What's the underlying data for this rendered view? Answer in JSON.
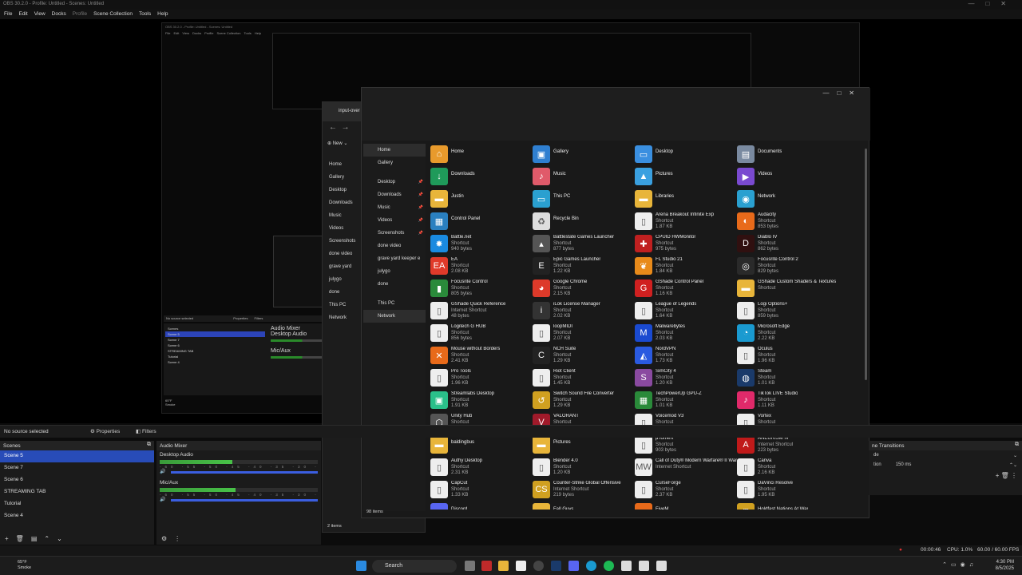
{
  "obs": {
    "title": "OBS 30.2.0 - Profile: Untitled - Scenes: Untitled",
    "menu": [
      "File",
      "Edit",
      "View",
      "Docks",
      "Profile",
      "Scene Collection",
      "Tools",
      "Help"
    ],
    "no_source": "No source selected",
    "properties": "Properties",
    "filters": "Filters",
    "scenes_title": "Scenes",
    "scenes": [
      "Scene 5",
      "Scene 7",
      "Scene 6",
      "STREAMING TAB",
      "Tutorial",
      "Scene 4"
    ],
    "mixer_title": "Audio Mixer",
    "desktop_audio": "Desktop Audio",
    "mic_aux": "Mic/Aux",
    "desktop_level": 0.46,
    "mic_level": 0.48,
    "scale": "-60 -55 -50 -45 -40 -35 -30 -25 -20",
    "transitions_title": "ne Transitions",
    "transition_type": "de",
    "duration_label": "tion",
    "duration": "150 ms",
    "status": {
      "rec_time": "00:00:46",
      "cpu": "CPU: 1.0%",
      "fps": "60.00 / 60.00 FPS"
    }
  },
  "nested": {
    "title": "OBS 30.2.0 - Profile: Untitled - Scenes: Untitled",
    "menu": [
      "File",
      "Edit",
      "View",
      "Docks",
      "Profile",
      "Scene Collection",
      "Tools",
      "Help"
    ],
    "no_source": "No source selected",
    "properties": "Properties",
    "filters": "Filters",
    "scenes_title": "Scenes",
    "scenes": [
      "Scene 5",
      "Scene 7",
      "Scene 6",
      "STREAMING TAB",
      "Tutorial",
      "Scene 4"
    ],
    "mixer_title": "Audio Mixer",
    "desktop_audio": "Desktop Audio",
    "mic_aux": "Mic/Aux",
    "weather": "65°F",
    "weather_sub": "Smoke"
  },
  "explorer_back": {
    "tab": "input-over",
    "new": "New",
    "sidebar": [
      "Home",
      "Gallery",
      "Desktop",
      "Downloads",
      "Music",
      "Videos",
      "Screenshots",
      "done video",
      "grave yard",
      "julygo",
      "done",
      "This PC",
      "Network"
    ],
    "footer": "2 items"
  },
  "explorer": {
    "sidebar": [
      {
        "label": "Home",
        "sel": true
      },
      {
        "label": "Gallery"
      },
      {
        "sep": true
      },
      {
        "label": "Desktop",
        "pin": true
      },
      {
        "label": "Downloads",
        "pin": true
      },
      {
        "label": "Music",
        "pin": true
      },
      {
        "label": "Videos",
        "pin": true
      },
      {
        "label": "Screenshots",
        "pin": true
      },
      {
        "label": "done video"
      },
      {
        "label": "grave yard keeper e"
      },
      {
        "label": "julygo"
      },
      {
        "label": "done"
      },
      {
        "sep": true
      },
      {
        "label": "This PC"
      },
      {
        "label": "Network",
        "sel": true
      }
    ],
    "footer": "98 items",
    "items": [
      {
        "n": "Home",
        "c": "#e89a2c",
        "g": "⌂"
      },
      {
        "n": "Gallery",
        "c": "#2f7fd0",
        "g": "▣"
      },
      {
        "n": "Desktop",
        "c": "#3a8fe0",
        "g": "▭"
      },
      {
        "n": "Documents",
        "c": "#7a8aa0",
        "g": "▤"
      },
      {
        "n": "Downloads",
        "c": "#1f9a5a",
        "g": "↓"
      },
      {
        "n": "Music",
        "c": "#e05a6a",
        "g": "♪"
      },
      {
        "n": "Pictures",
        "c": "#3aa0e0",
        "g": "▲"
      },
      {
        "n": "Videos",
        "c": "#7a4ad0",
        "g": "▶"
      },
      {
        "n": "Justin",
        "c": "#e8b53a",
        "g": "▬"
      },
      {
        "n": "This PC",
        "c": "#2aa0d0",
        "g": "▭"
      },
      {
        "n": "Libraries",
        "c": "#e8b53a",
        "g": "▬"
      },
      {
        "n": "Network",
        "c": "#2aa0d0",
        "g": "◉"
      },
      {
        "n": "Control Panel",
        "c": "#2a80c0",
        "g": "▦"
      },
      {
        "n": "Recycle Bin",
        "c": "#ddd",
        "g": "♻"
      },
      {
        "n": "Arena Breakout Infinite Exp",
        "s": "Shortcut",
        "z": "1.87 KB",
        "c": "#eee",
        "g": "▯"
      },
      {
        "n": "Audacity",
        "s": "Shortcut",
        "z": "853 bytes",
        "c": "#e86a1a",
        "g": "◐"
      },
      {
        "n": "Battle.net",
        "s": "Shortcut",
        "z": "940 bytes",
        "c": "#1a8ae0",
        "g": "✸"
      },
      {
        "n": "Battlestate Games Launcher",
        "s": "Shortcut",
        "z": "877 bytes",
        "c": "#555",
        "g": "▴"
      },
      {
        "n": "CPUID HWMonitor",
        "s": "Shortcut",
        "z": "975 bytes",
        "c": "#c02020",
        "g": "✚"
      },
      {
        "n": "Diablo IV",
        "s": "Shortcut",
        "z": "862 bytes",
        "c": "#301010",
        "g": "D"
      },
      {
        "n": "EA",
        "s": "Shortcut",
        "z": "2.08 KB",
        "c": "#e03a2a",
        "g": "EA"
      },
      {
        "n": "Epic Games Launcher",
        "s": "Shortcut",
        "z": "1.22 KB",
        "c": "#222",
        "g": "E"
      },
      {
        "n": "FL Studio 21",
        "s": "Shortcut",
        "z": "1.84 KB",
        "c": "#e88a1a",
        "g": "❦"
      },
      {
        "n": "Focusrite Control 2",
        "s": "Shortcut",
        "z": "829 bytes",
        "c": "#2a2a2a",
        "g": "◎"
      },
      {
        "n": "Focusrite Control",
        "s": "Shortcut",
        "z": "805 bytes",
        "c": "#2a8a3a",
        "g": "▮"
      },
      {
        "n": "Google Chrome",
        "s": "Shortcut",
        "z": "2.15 KB",
        "c": "#dd3a2a",
        "g": "◕"
      },
      {
        "n": "GShade Control Panel",
        "s": "Shortcut",
        "z": "1.16 KB",
        "c": "#d02020",
        "g": "G"
      },
      {
        "n": "GShade Custom Shaders & Textures",
        "s": "Shortcut",
        "c": "#e8b53a",
        "g": "▬"
      },
      {
        "n": "GShade Quick Reference",
        "s": "Internet Shortcut",
        "z": "48 bytes",
        "c": "#eee",
        "g": "▯"
      },
      {
        "n": "iLok License Manager",
        "s": "Shortcut",
        "z": "2.02 KB",
        "c": "#333",
        "g": "i"
      },
      {
        "n": "League of Legends",
        "s": "Shortcut",
        "z": "1.64 KB",
        "c": "#eee",
        "g": "▯"
      },
      {
        "n": "Logi Options+",
        "s": "Shortcut",
        "z": "859 bytes",
        "c": "#eee",
        "g": "▯"
      },
      {
        "n": "Logitech G HUB",
        "s": "Shortcut",
        "z": "856 bytes",
        "c": "#eee",
        "g": "▯"
      },
      {
        "n": "loopMIDI",
        "s": "Shortcut",
        "z": "2.07 KB",
        "c": "#eee",
        "g": "▯"
      },
      {
        "n": "Malwarebytes",
        "s": "Shortcut",
        "z": "2.03 KB",
        "c": "#1a4ad0",
        "g": "M"
      },
      {
        "n": "Microsoft Edge",
        "s": "Shortcut",
        "z": "2.22 KB",
        "c": "#1a9ad0",
        "g": "◔"
      },
      {
        "n": "Mouse without Borders",
        "s": "Shortcut",
        "z": "2.41 KB",
        "c": "#e86a1a",
        "g": "✕"
      },
      {
        "n": "NCH Suite",
        "s": "Shortcut",
        "z": "1.29 KB",
        "c": "#222",
        "g": "C"
      },
      {
        "n": "NordVPN",
        "s": "Shortcut",
        "z": "1.73 KB",
        "c": "#2a5ae0",
        "g": "◭"
      },
      {
        "n": "Oculus",
        "s": "Shortcut",
        "z": "1.96 KB",
        "c": "#eee",
        "g": "▯"
      },
      {
        "n": "Pro Tools",
        "s": "Shortcut",
        "z": "1.96 KB",
        "c": "#eee",
        "g": "▯"
      },
      {
        "n": "Riot Client",
        "s": "Shortcut",
        "z": "1.45 KB",
        "c": "#eee",
        "g": "▯"
      },
      {
        "n": "SimCity 4",
        "s": "Shortcut",
        "z": "1.20 KB",
        "c": "#8a4aa0",
        "g": "S"
      },
      {
        "n": "Steam",
        "s": "Shortcut",
        "z": "1.01 KB",
        "c": "#1a3a6a",
        "g": "◍"
      },
      {
        "n": "Streamlabs Desktop",
        "s": "Shortcut",
        "z": "1.91 KB",
        "c": "#2ac08a",
        "g": "▣"
      },
      {
        "n": "Switch Sound File Converter",
        "s": "Shortcut",
        "z": "1.29 KB",
        "c": "#d0a020",
        "g": "↺"
      },
      {
        "n": "TechPowerUp GPU-Z",
        "s": "Shortcut",
        "z": "1.01 KB",
        "c": "#2a8a3a",
        "g": "▦"
      },
      {
        "n": "TikTok LIVE Studio",
        "s": "Shortcut",
        "z": "1.11 KB",
        "c": "#e02a6a",
        "g": "♪"
      },
      {
        "n": "Unity Hub",
        "s": "Shortcut",
        "z": "1.82 KB",
        "c": "#555",
        "g": "⬡"
      },
      {
        "n": "VALORANT",
        "s": "Shortcut",
        "z": "1.58 KB",
        "c": "#a01a2a",
        "g": "V"
      },
      {
        "n": "Voicemod V3",
        "s": "Shortcut",
        "z": "1.79 KB",
        "c": "#eee",
        "g": "▯"
      },
      {
        "n": "Vortex",
        "s": "Shortcut",
        "z": "2.00 KB",
        "c": "#eee",
        "g": "▯"
      },
      {
        "n": "baldingbus",
        "c": "#e8b53a",
        "g": "▬"
      },
      {
        "n": "Pictures",
        "c": "#e8b53a",
        "g": "▬"
      },
      {
        "n": "µTorrent",
        "s": "Shortcut",
        "z": "903 bytes",
        "c": "#eee",
        "g": "▯"
      },
      {
        "n": "ANEURISM IV",
        "s": "Internet Shortcut",
        "z": "223 bytes",
        "c": "#c01a1a",
        "g": "A"
      },
      {
        "n": "Authy Desktop",
        "s": "Shortcut",
        "z": "2.31 KB",
        "c": "#eee",
        "g": "▯"
      },
      {
        "n": "Blender 4.0",
        "s": "Shortcut",
        "z": "1.20 KB",
        "c": "#eee",
        "g": "▯"
      },
      {
        "n": "Call of Duty® Modern Warfare® II Warzone™ 2.0",
        "s": "Internet Shortcut",
        "c": "#eee",
        "g": "MW"
      },
      {
        "n": "Canva",
        "s": "Shortcut",
        "z": "2.16 KB",
        "c": "#eee",
        "g": "▯"
      },
      {
        "n": "CapCut",
        "s": "Shortcut",
        "z": "1.33 KB",
        "c": "#eee",
        "g": "▯"
      },
      {
        "n": "Counter-Strike Global Offensive",
        "s": "Internet Shortcut",
        "z": "219 bytes",
        "c": "#d0a020",
        "g": "CS"
      },
      {
        "n": "CurseForge",
        "s": "Shortcut",
        "z": "2.37 KB",
        "c": "#eee",
        "g": "▯"
      },
      {
        "n": "DaVinci Resolve",
        "s": "Shortcut",
        "z": "1.95 KB",
        "c": "#eee",
        "g": "▯"
      },
      {
        "n": "Discord",
        "c": "#5865f2",
        "g": "◕"
      },
      {
        "n": "Fall Guys",
        "c": "#e8b53a",
        "g": "▬"
      },
      {
        "n": "FiveM",
        "c": "#e86a1a",
        "g": "▬"
      },
      {
        "n": "Holdfast Nations At War",
        "c": "#d0a020",
        "g": "♜"
      }
    ]
  },
  "taskbar": {
    "weather": "65°F",
    "weather_sub": "Smoke",
    "search": "Search",
    "time": "4:30 PM",
    "date": "8/5/2025"
  }
}
